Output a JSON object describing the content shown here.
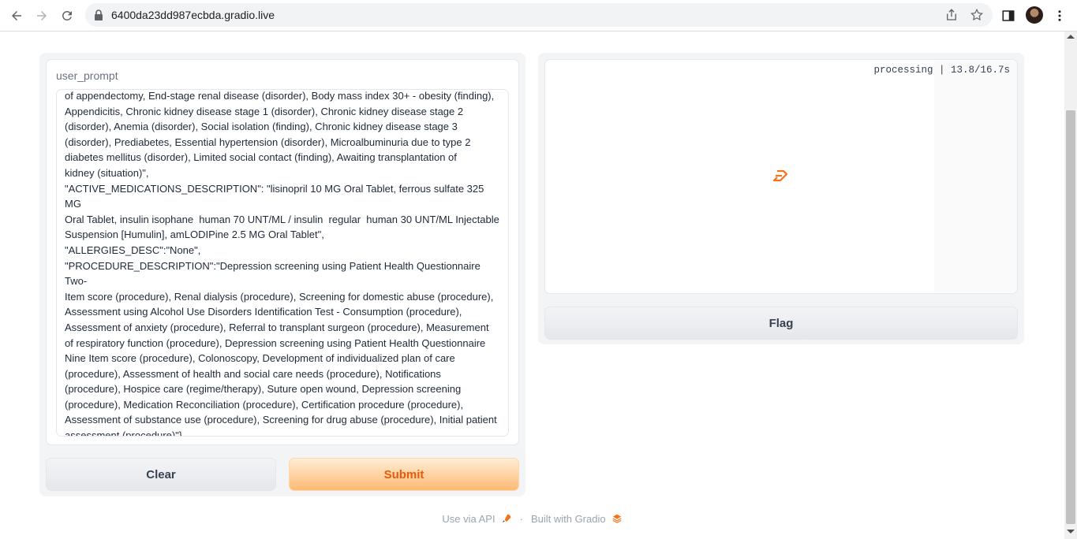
{
  "browser": {
    "url": "6400da23dd987ecbda.gradio.live"
  },
  "input": {
    "label": "user_prompt",
    "value": "of appendectomy, End-stage renal disease (disorder), Body mass index 30+ - obesity (finding),\nAppendicitis, Chronic kidney disease stage 1 (disorder), Chronic kidney disease stage 2\n(disorder), Anemia (disorder), Social isolation (finding), Chronic kidney disease stage 3\n(disorder), Prediabetes, Essential hypertension (disorder), Microalbuminuria due to type 2\ndiabetes mellitus (disorder), Limited social contact (finding), Awaiting transplantation of\nkidney (situation)\",\n\"ACTIVE_MEDICATIONS_DESCRIPTION\": \"lisinopril 10 MG Oral Tablet, ferrous sulfate 325 MG\nOral Tablet, insulin isophane  human 70 UNT/ML / insulin  regular  human 30 UNT/ML Injectable\nSuspension [Humulin], amLODIPine 2.5 MG Oral Tablet\",\n\"ALLERGIES_DESC\":\"None\",\n\"PROCEDURE_DESCRIPTION\":\"Depression screening using Patient Health Questionnaire Two-\nItem score (procedure), Renal dialysis (procedure), Screening for domestic abuse (procedure),\nAssessment using Alcohol Use Disorders Identification Test - Consumption (procedure),\nAssessment of anxiety (procedure), Referral to transplant surgeon (procedure), Measurement\nof respiratory function (procedure), Depression screening using Patient Health Questionnaire\nNine Item score (procedure), Colonoscopy, Development of individualized plan of care\n(procedure), Assessment of health and social care needs (procedure), Notifications\n(procedure), Hospice care (regime/therapy), Suture open wound, Depression screening\n(procedure), Medication Reconciliation (procedure), Certification procedure (procedure),\nAssessment of substance use (procedure), Screening for drug abuse (procedure), Initial patient\nassessment (procedure)\"}"
  },
  "buttons": {
    "clear": "Clear",
    "submit": "Submit",
    "flag": "Flag"
  },
  "output": {
    "status": "processing | 13.8/16.7s"
  },
  "footer": {
    "api_link": "Use via API",
    "separator": "·",
    "built_with": "Built with Gradio"
  },
  "colors": {
    "accent": "#f97316",
    "submit_text": "#ea580c"
  }
}
